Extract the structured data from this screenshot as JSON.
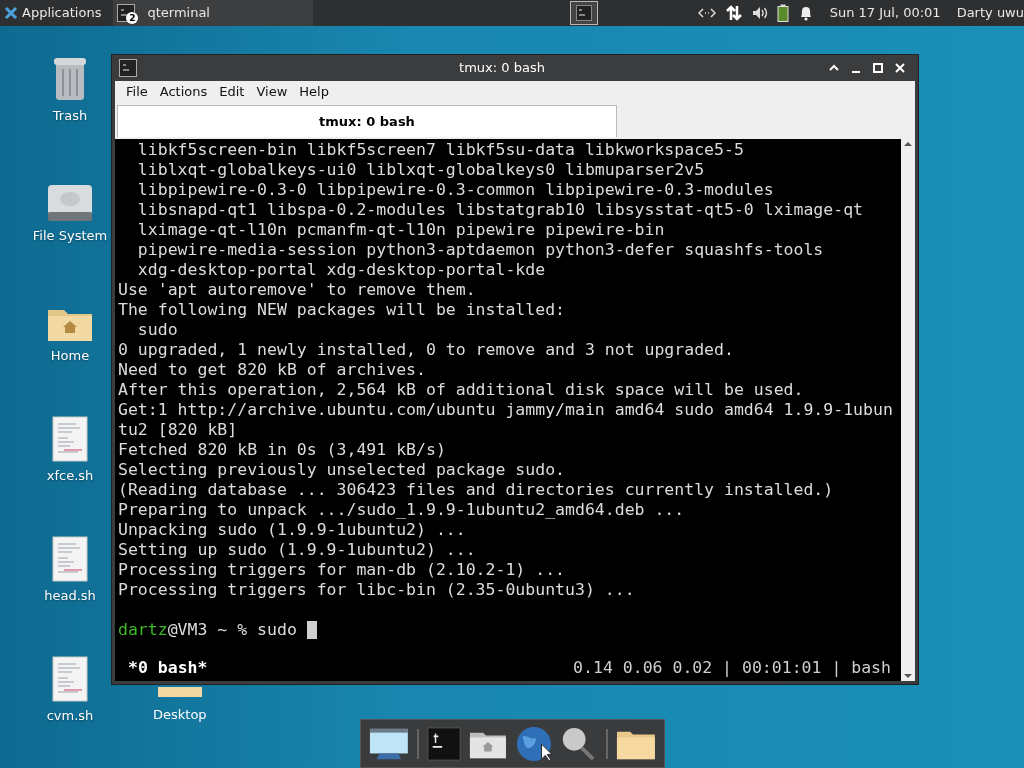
{
  "top_panel": {
    "apps_menu": "Applications",
    "tasks": [
      {
        "label": "qterminal",
        "count": "2",
        "selected": true
      }
    ],
    "clock": "Sun 17 Jul, 00:01",
    "user": "Darty uwu"
  },
  "desktop_icons": [
    {
      "kind": "trash",
      "label": "Trash"
    },
    {
      "kind": "drive",
      "label": "File System"
    },
    {
      "kind": "home",
      "label": "Home"
    },
    {
      "kind": "script",
      "label": "xfce.sh"
    },
    {
      "kind": "script",
      "label": "head.sh"
    },
    {
      "kind": "script",
      "label": "cvm.sh"
    }
  ],
  "hidden_icon": {
    "label": "Desktop"
  },
  "window": {
    "title": "tmux: 0 bash",
    "menu": [
      "File",
      "Actions",
      "Edit",
      "View",
      "Help"
    ],
    "tabs": [
      {
        "label": "tmux: 0 bash",
        "selected": true
      }
    ],
    "lines": [
      "  libkf5screen-bin libkf5screen7 libkf5su-data libkworkspace5-5",
      "  liblxqt-globalkeys-ui0 liblxqt-globalkeys0 libmuparser2v5",
      "  libpipewire-0.3-0 libpipewire-0.3-common libpipewire-0.3-modules",
      "  libsnapd-qt1 libspa-0.2-modules libstatgrab10 libsysstat-qt5-0 lximage-qt",
      "  lximage-qt-l10n pcmanfm-qt-l10n pipewire pipewire-bin",
      "  pipewire-media-session python3-aptdaemon python3-defer squashfs-tools",
      "  xdg-desktop-portal xdg-desktop-portal-kde",
      "Use 'apt autoremove' to remove them.",
      "The following NEW packages will be installed:",
      "  sudo",
      "0 upgraded, 1 newly installed, 0 to remove and 3 not upgraded.",
      "Need to get 820 kB of archives.",
      "After this operation, 2,564 kB of additional disk space will be used.",
      "Get:1 http://archive.ubuntu.com/ubuntu jammy/main amd64 sudo amd64 1.9.9-1ubun",
      "tu2 [820 kB]",
      "Fetched 820 kB in 0s (3,491 kB/s)",
      "Selecting previously unselected package sudo.",
      "(Reading database ... 306423 files and directories currently installed.)",
      "Preparing to unpack .../sudo_1.9.9-1ubuntu2_amd64.deb ...",
      "Unpacking sudo (1.9.9-1ubuntu2) ...",
      "Setting up sudo (1.9.9-1ubuntu2) ...",
      "Processing triggers for man-db (2.10.2-1) ...",
      "Processing triggers for libc-bin (2.35-0ubuntu3) ..."
    ],
    "prompt": {
      "user": "dartz",
      "host": "@VM3 ~ % sudo"
    },
    "status_left": "*0 bash*",
    "status_right": "0.14 0.06 0.02 | 00:01:01 | bash"
  },
  "dock": [
    {
      "kind": "desktop"
    },
    {
      "kind": "terminal"
    },
    {
      "kind": "home"
    },
    {
      "kind": "globe"
    },
    {
      "kind": "search"
    },
    {
      "kind": "folder"
    }
  ]
}
